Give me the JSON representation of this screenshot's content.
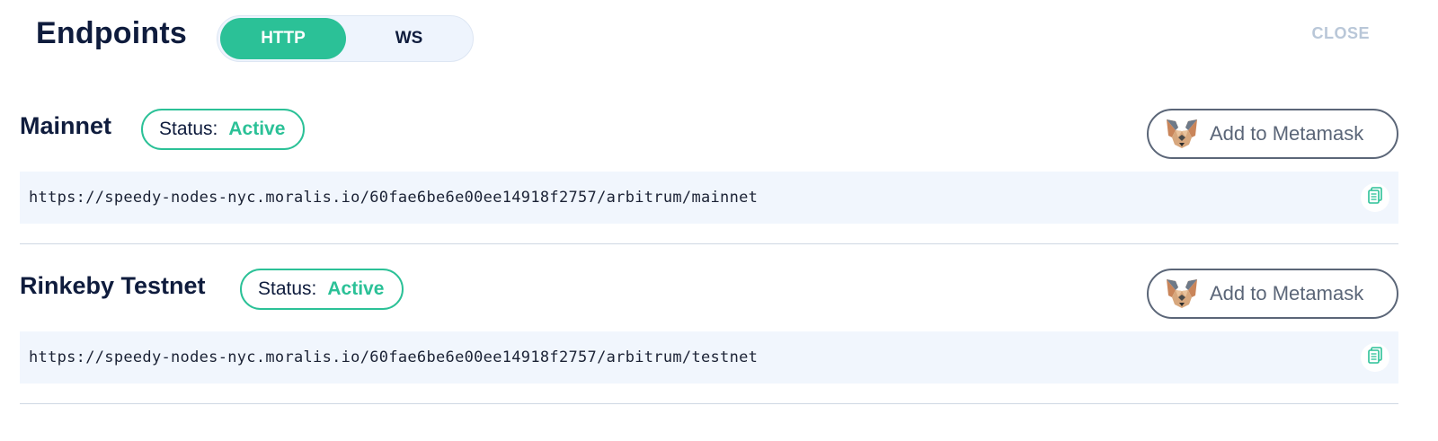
{
  "header": {
    "title": "Endpoints",
    "tabs": [
      {
        "label": "HTTP",
        "active": true
      },
      {
        "label": "WS",
        "active": false
      }
    ],
    "close_label": "CLOSE"
  },
  "networks": [
    {
      "name": "Mainnet",
      "status_label": "Status:",
      "status_value": "Active",
      "metamask_label": "Add to Metamask",
      "url": "https://speedy-nodes-nyc.moralis.io/60fae6be6e00ee14918f2757/arbitrum/mainnet"
    },
    {
      "name": "Rinkeby Testnet",
      "status_label": "Status:",
      "status_value": "Active",
      "metamask_label": "Add to Metamask",
      "url": "https://speedy-nodes-nyc.moralis.io/60fae6be6e00ee14918f2757/arbitrum/testnet"
    }
  ],
  "icons": {
    "metamask": "metamask-fox-icon",
    "copy": "copy-icon"
  },
  "colors": {
    "accent": "#2bc197",
    "title": "#0f1c3d",
    "url_bg": "#f1f6fd",
    "close": "#b9c7d8"
  }
}
